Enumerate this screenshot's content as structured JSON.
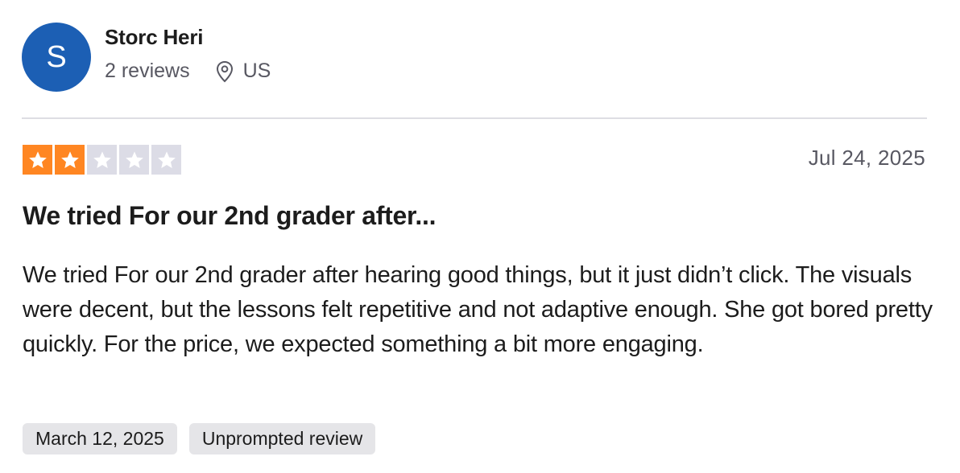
{
  "reviewer": {
    "initial": "S",
    "name": "Storc Heri",
    "review_count": "2 reviews",
    "location": "US",
    "avatar_color": "#1c5fb4"
  },
  "review": {
    "rating": 2,
    "max_rating": 5,
    "date": "Jul 24, 2025",
    "title": "We tried For our 2nd grader after...",
    "body": "We tried For our 2nd grader after hearing good things, but it just didn’t click. The visuals were decent, but the lessons felt repetitive and not adaptive enough. She got bored pretty quickly. For the price, we expected something a bit more engaging."
  },
  "tags": {
    "experience_date": "March 12, 2025",
    "review_type": "Unprompted review"
  },
  "colors": {
    "star_filled": "#ff8622",
    "star_empty": "#dcdce6",
    "divider": "#dedee3",
    "tag_bg": "#e5e5e8"
  },
  "icons": {
    "location": "location-pin-icon",
    "star": "star-icon"
  }
}
